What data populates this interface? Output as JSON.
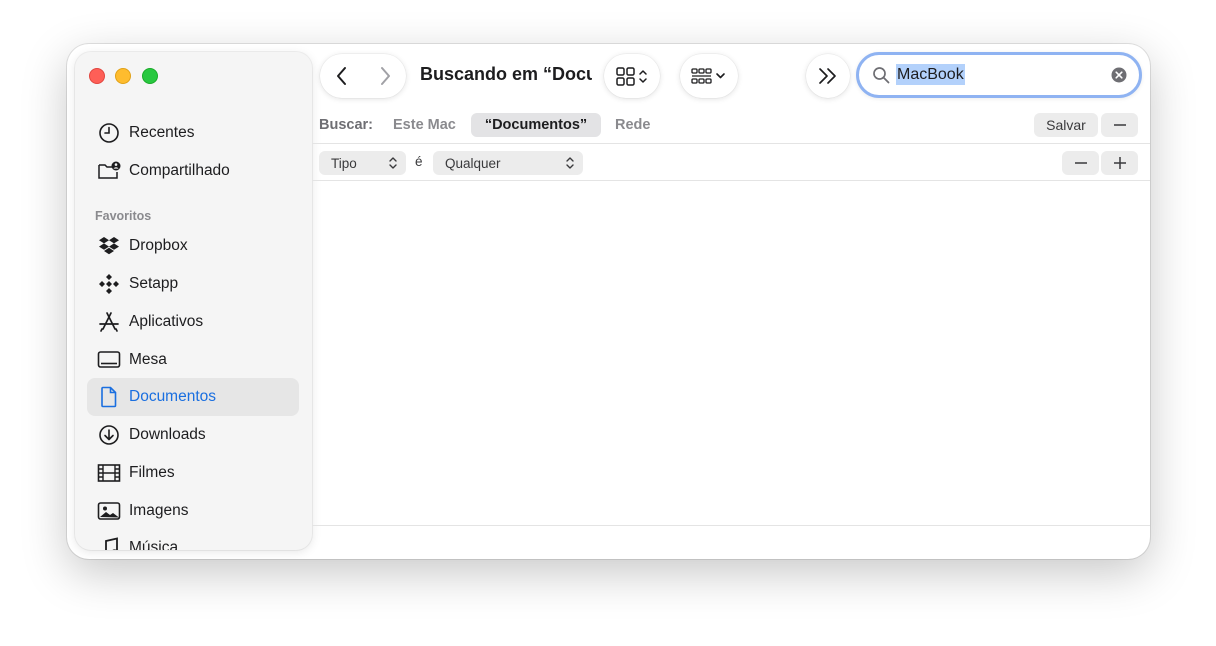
{
  "sidebar": {
    "recents": "Recentes",
    "shared": "Compartilhado",
    "favorites_header": "Favoritos",
    "items": [
      {
        "label": "Dropbox",
        "icon": "dropbox-icon"
      },
      {
        "label": "Setapp",
        "icon": "setapp-icon"
      },
      {
        "label": "Aplicativos",
        "icon": "applications-icon"
      },
      {
        "label": "Mesa",
        "icon": "desktop-icon"
      },
      {
        "label": "Documentos",
        "icon": "document-icon",
        "selected": true
      },
      {
        "label": "Downloads",
        "icon": "download-icon"
      },
      {
        "label": "Filmes",
        "icon": "film-icon"
      },
      {
        "label": "Imagens",
        "icon": "image-icon"
      },
      {
        "label": "Música",
        "icon": "music-icon"
      }
    ]
  },
  "toolbar": {
    "title": "Buscando em “Documentos”",
    "search_value": "MacBook"
  },
  "scope": {
    "label": "Buscar:",
    "this_mac": "Este Mac",
    "documents": "“Documentos”",
    "network": "Rede",
    "save": "Salvar"
  },
  "criteria": {
    "attribute": "Tipo",
    "operator": "é",
    "value": "Qualquer"
  },
  "colors": {
    "accent": "#1a6fe0",
    "search_ring": "#8fb3f2",
    "selection": "#b3d1fb",
    "close": "#fe5f57",
    "minimize": "#febc2e",
    "zoom": "#28c840"
  }
}
